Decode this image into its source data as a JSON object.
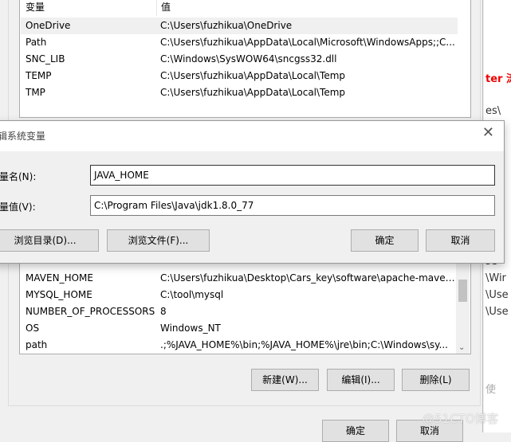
{
  "env_list": {
    "headers": [
      "变量",
      "值"
    ],
    "top_rows": [
      {
        "name": "OneDrive",
        "value": "C:\\Users\\fuzhikua\\OneDrive"
      },
      {
        "name": "Path",
        "value": "C:\\Users\\fuzhikua\\AppData\\Local\\Microsoft\\WindowsApps;;C..."
      },
      {
        "name": "SNC_LIB",
        "value": "C:\\Windows\\SysWOW64\\sncgss32.dll"
      },
      {
        "name": "TEMP",
        "value": "C:\\Users\\fuzhikua\\AppData\\Local\\Temp"
      },
      {
        "name": "TMP",
        "value": "C:\\Users\\fuzhikua\\AppData\\Local\\Temp"
      }
    ],
    "system_rows": [
      {
        "name": "MAVEN_HOME",
        "value": "C:\\Users\\fuzhikua\\Desktop\\Cars_key\\software\\apache-maven..."
      },
      {
        "name": "MYSQL_HOME",
        "value": "C:\\tool\\mysql"
      },
      {
        "name": "NUMBER_OF_PROCESSORS",
        "value": "8"
      },
      {
        "name": "OS",
        "value": "Windows_NT"
      },
      {
        "name": "path",
        "value": ".;%JAVA_HOME%\\bin;%JAVA_HOME%\\jre\\bin;C:\\Windows\\sy..."
      }
    ],
    "buttons": {
      "new": "新建(W)...",
      "edit": "编辑(I)...",
      "delete": "删除(L)"
    },
    "ok": "确定",
    "cancel": "取消"
  },
  "dialog": {
    "title": "编辑系统变量",
    "name_label": "变量名(N):",
    "name_value": "JAVA_HOME",
    "value_label": "变量值(V):",
    "value_value": "C:\\Program Files\\Java\\jdk1.8.0_77",
    "browse_dir": "浏览目录(D)...",
    "browse_file": "浏览文件(F)...",
    "ok": "确定",
    "cancel": "取消",
    "close_icon": "close-icon"
  },
  "background_fragments": [
    "ter 涛",
    "es\\",
    "，",
    "如",
    "in",
    "se",
    "se",
    "\\Wir",
    "\\Use",
    "\\Use",
    "使"
  ],
  "watermark": "@51CTO博客"
}
